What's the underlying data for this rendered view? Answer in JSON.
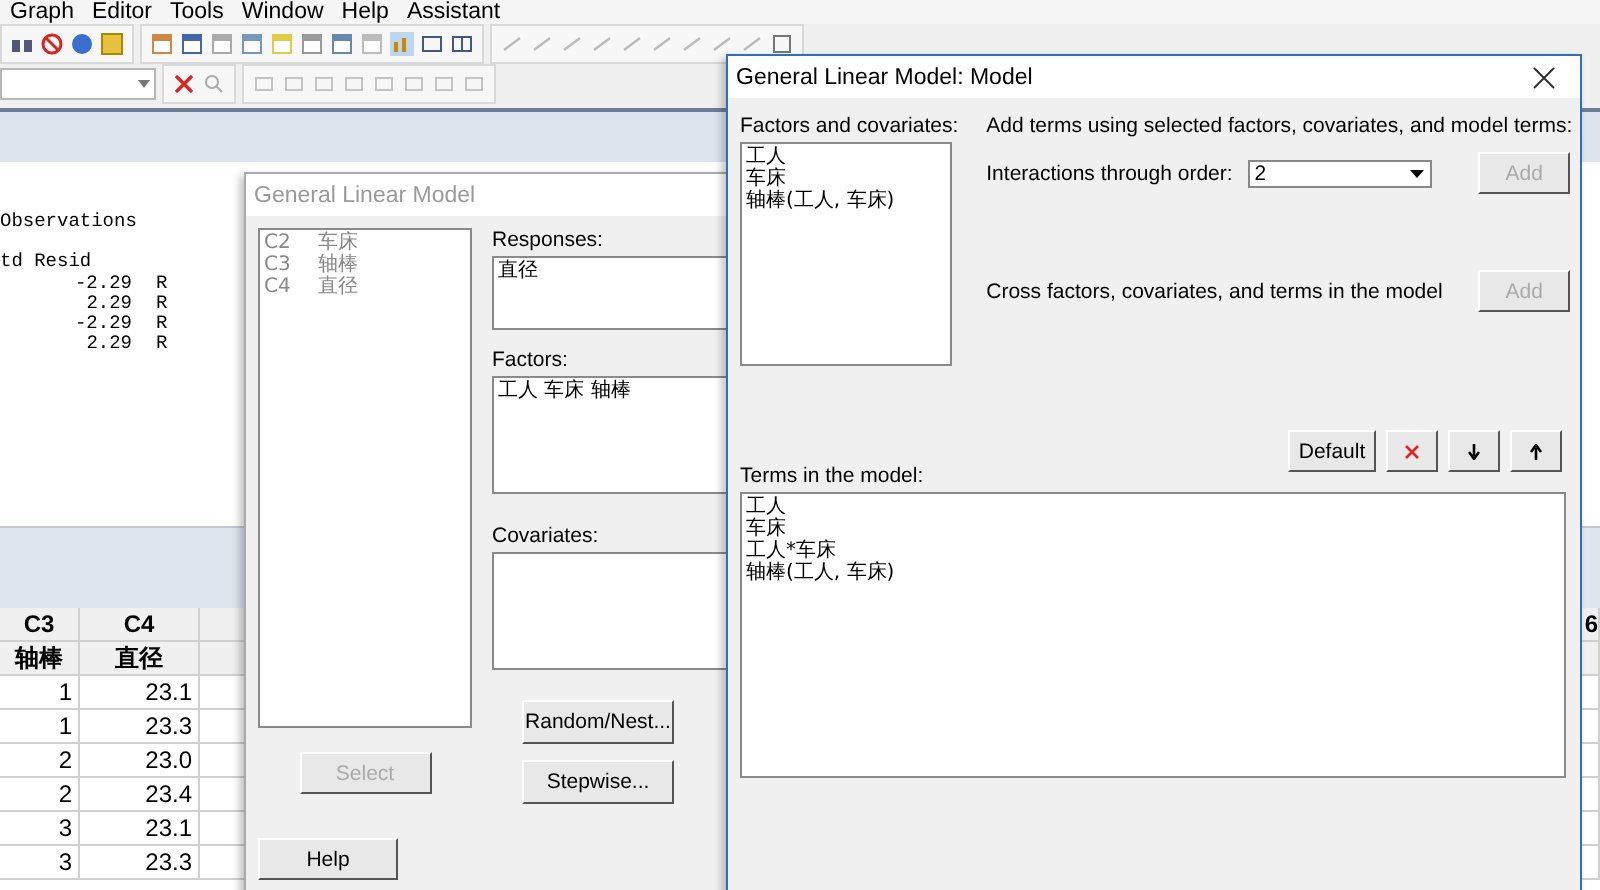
{
  "menu_bar": [
    "Graph",
    "Editor",
    "Tools",
    "Window",
    "Help",
    "Assistant"
  ],
  "session": {
    "heading": "Observations",
    "column_header": "td Resid",
    "rows": [
      {
        "value": "-2.29",
        "flag": "R"
      },
      {
        "value": "2.29",
        "flag": "R"
      },
      {
        "value": "-2.29",
        "flag": "R"
      },
      {
        "value": "2.29",
        "flag": "R"
      }
    ]
  },
  "worksheet": {
    "columns": [
      {
        "id": "C3",
        "name": "轴棒"
      },
      {
        "id": "C4",
        "name": "直径"
      }
    ],
    "rows": [
      [
        "1",
        "23.1"
      ],
      [
        "1",
        "23.3"
      ],
      [
        "2",
        "23.0"
      ],
      [
        "2",
        "23.4"
      ],
      [
        "3",
        "23.1"
      ],
      [
        "3",
        "23.3"
      ]
    ],
    "edge_column": "6"
  },
  "glm_dialog": {
    "title": "General Linear Model",
    "active": false,
    "variables": [
      {
        "id": "C2",
        "name": "车床"
      },
      {
        "id": "C3",
        "name": "轴棒"
      },
      {
        "id": "C4",
        "name": "直径"
      }
    ],
    "fields": [
      {
        "label": "Responses:",
        "value": "直径"
      },
      {
        "label": "Factors:",
        "value": "工人 车床 轴棒"
      },
      {
        "label": "Covariates:"
      }
    ],
    "select_button": {
      "label": "Select",
      "disabled": true
    },
    "buttons": [
      {
        "label": "Random/Nest...",
        "disabled": false
      },
      {
        "label": "Stepwise...",
        "disabled": false
      }
    ],
    "help_button": "Help"
  },
  "model_dialog": {
    "title": "General Linear Model: Model",
    "active": true,
    "factors_label": "Factors and covariates:",
    "factors": [
      "工人",
      "车床",
      "轴棒(工人, 车床)"
    ],
    "add_terms_text": "Add terms using selected factors, covariates, and model terms:",
    "interactions_label": "Interactions through order:",
    "interactions_value": "2",
    "interactions_add": {
      "label": "Add",
      "disabled": true
    },
    "cross_text": "Cross factors, covariates, and terms in the model",
    "cross_add": {
      "label": "Add",
      "disabled": true
    },
    "default_button": "Default",
    "terms_label": "Terms in the model:",
    "terms": [
      "工人",
      "车床",
      "工人*车床",
      "轴棒(工人, 车床)"
    ]
  }
}
